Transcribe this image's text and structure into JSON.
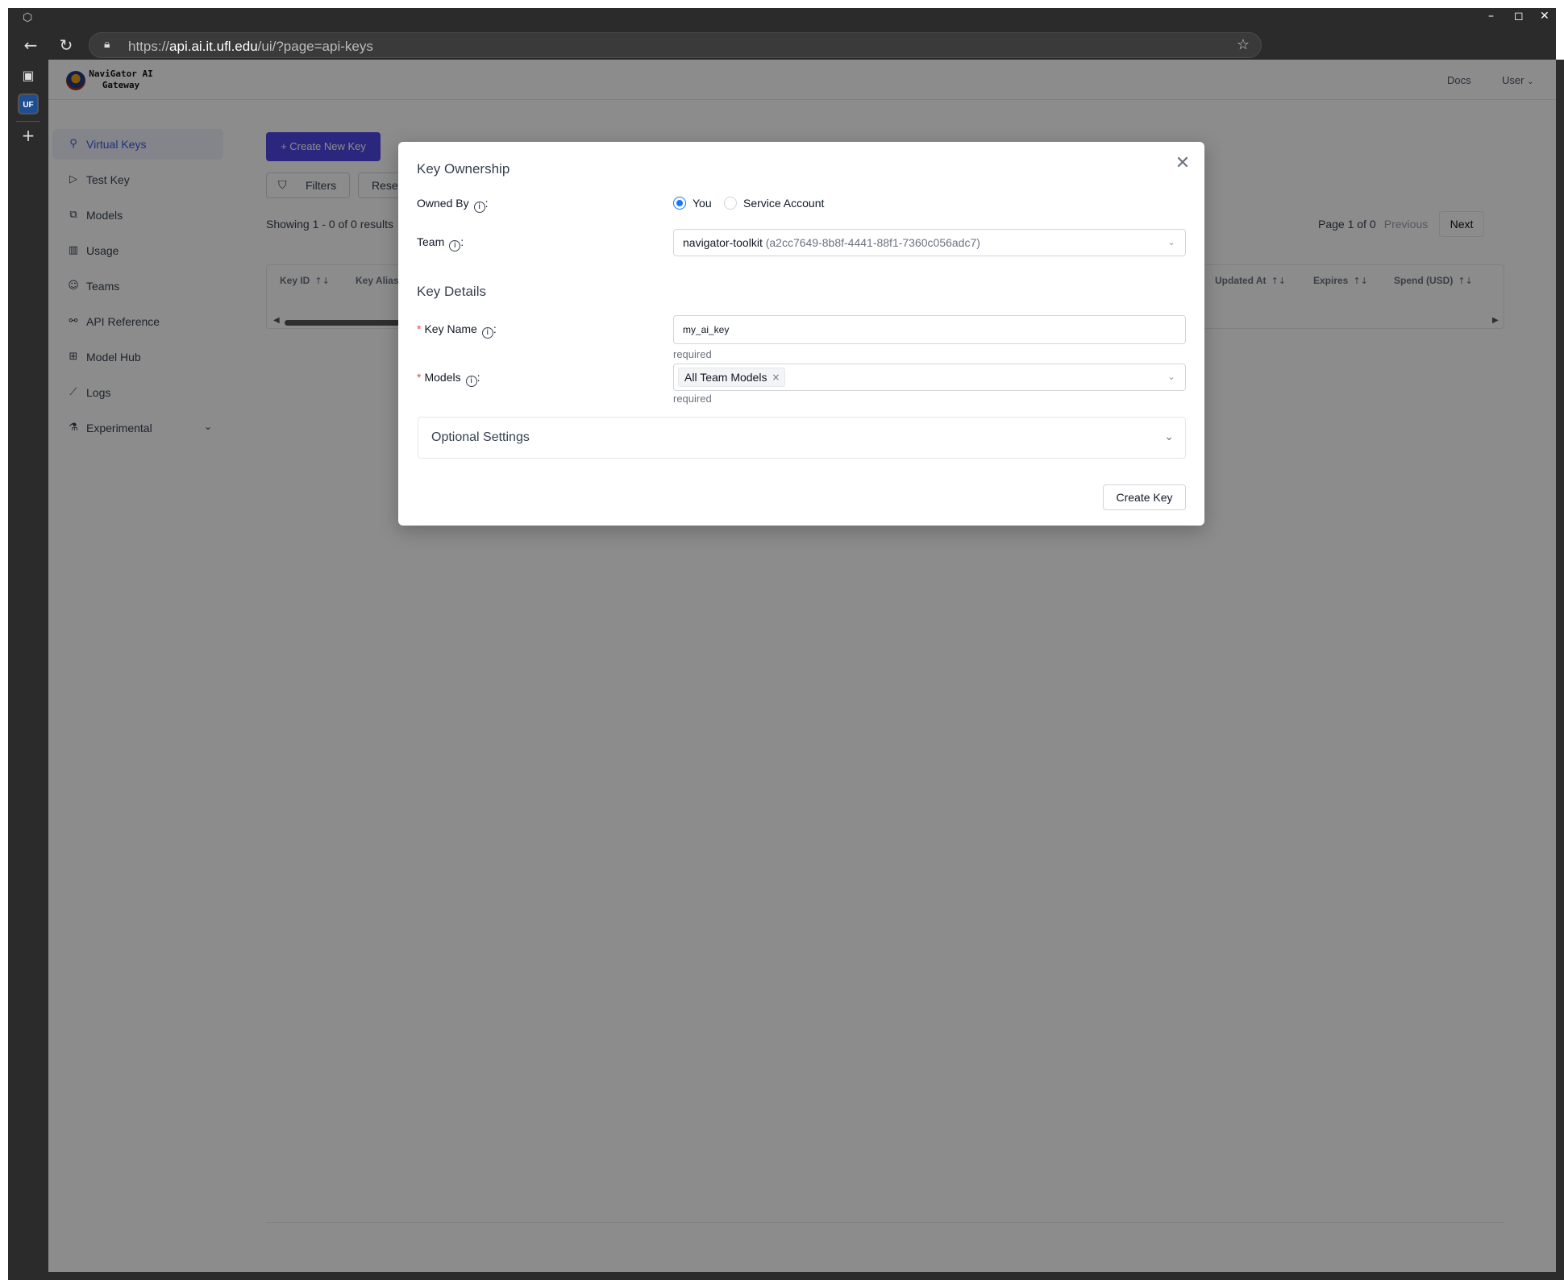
{
  "browser": {
    "url_prefix": "https://",
    "url_host": "api.ai.it.ufl.edu",
    "url_path": "/ui/?page=api-keys",
    "side_badge": "UF"
  },
  "app": {
    "logo_text_line1": "NaviGator AI",
    "logo_text_line2": "Gateway",
    "docs": "Docs",
    "user": "User"
  },
  "sidebar": {
    "items": [
      {
        "label": "Virtual Keys",
        "icon": "key-icon"
      },
      {
        "label": "Test Key",
        "icon": "play-circle-icon"
      },
      {
        "label": "Models",
        "icon": "blocks-icon"
      },
      {
        "label": "Usage",
        "icon": "bar-chart-icon"
      },
      {
        "label": "Teams",
        "icon": "team-icon"
      },
      {
        "label": "API Reference",
        "icon": "api-icon"
      },
      {
        "label": "Model Hub",
        "icon": "grid-icon"
      },
      {
        "label": "Logs",
        "icon": "line-chart-icon"
      },
      {
        "label": "Experimental",
        "icon": "flask-icon"
      }
    ]
  },
  "main": {
    "create_button": "+ Create New Key",
    "filters_button": "Filters",
    "reset_button": "Reset",
    "showing": "Showing 1 - 0 of 0 results",
    "page_info": "Page 1 of 0",
    "previous": "Previous",
    "next": "Next",
    "columns": [
      "Key ID",
      "Key Alias",
      "Updated At",
      "Expires",
      "Spend (USD)"
    ]
  },
  "modal": {
    "ownership_title": "Key Ownership",
    "owned_by_label": "Owned By",
    "owner_options": [
      "You",
      "Service Account"
    ],
    "owner_selected": "You",
    "team_label": "Team",
    "team_value": "navigator-toolkit",
    "team_id": "(a2cc7649-8b8f-4441-88f1-7360c056adc7)",
    "details_title": "Key Details",
    "key_name_label": "Key Name",
    "key_name_value": "my_ai_key",
    "key_name_hint": "required",
    "models_label": "Models",
    "models_tag": "All Team Models",
    "models_hint": "required",
    "optional_settings": "Optional Settings",
    "create_key_button": "Create Key"
  },
  "colors": {
    "accent": "#4f46e5",
    "radio_selected": "#1677ff",
    "required_star": "#ef4444",
    "active_nav": "#3b5bdb"
  }
}
